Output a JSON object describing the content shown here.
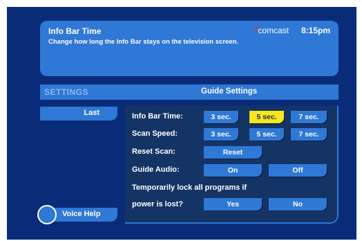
{
  "header": {
    "title": "Info Bar Time",
    "description": "Change how long the Info Bar stays on the television screen.",
    "brand": "comcast",
    "time": "8:15pm"
  },
  "settings_bar": {
    "left_label": "SETTINGS",
    "center_label": "Guide Settings"
  },
  "nav": {
    "last_label": "Last"
  },
  "rows": {
    "info_bar_time": {
      "label": "Info Bar Time:",
      "options": [
        "3 sec.",
        "5 sec.",
        "7 sec."
      ],
      "selected": "5 sec."
    },
    "scan_speed": {
      "label": "Scan Speed:",
      "options": [
        "3 sec.",
        "5 sec.",
        "7 sec."
      ]
    },
    "reset_scan": {
      "label": "Reset Scan:",
      "button": "Reset"
    },
    "guide_audio": {
      "label": "Guide Audio:",
      "options": [
        "On",
        "Off"
      ]
    },
    "lock_programs": {
      "label_line1": "Temporarily lock all programs if",
      "label_line2": "power is lost?",
      "options": [
        "Yes",
        "No"
      ]
    }
  },
  "voice_help": {
    "label": "Voice Help"
  },
  "colors": {
    "background": "#0a2c78",
    "accent": "#2f78d6",
    "panel": "#153466",
    "selected": "#f4e81c"
  }
}
